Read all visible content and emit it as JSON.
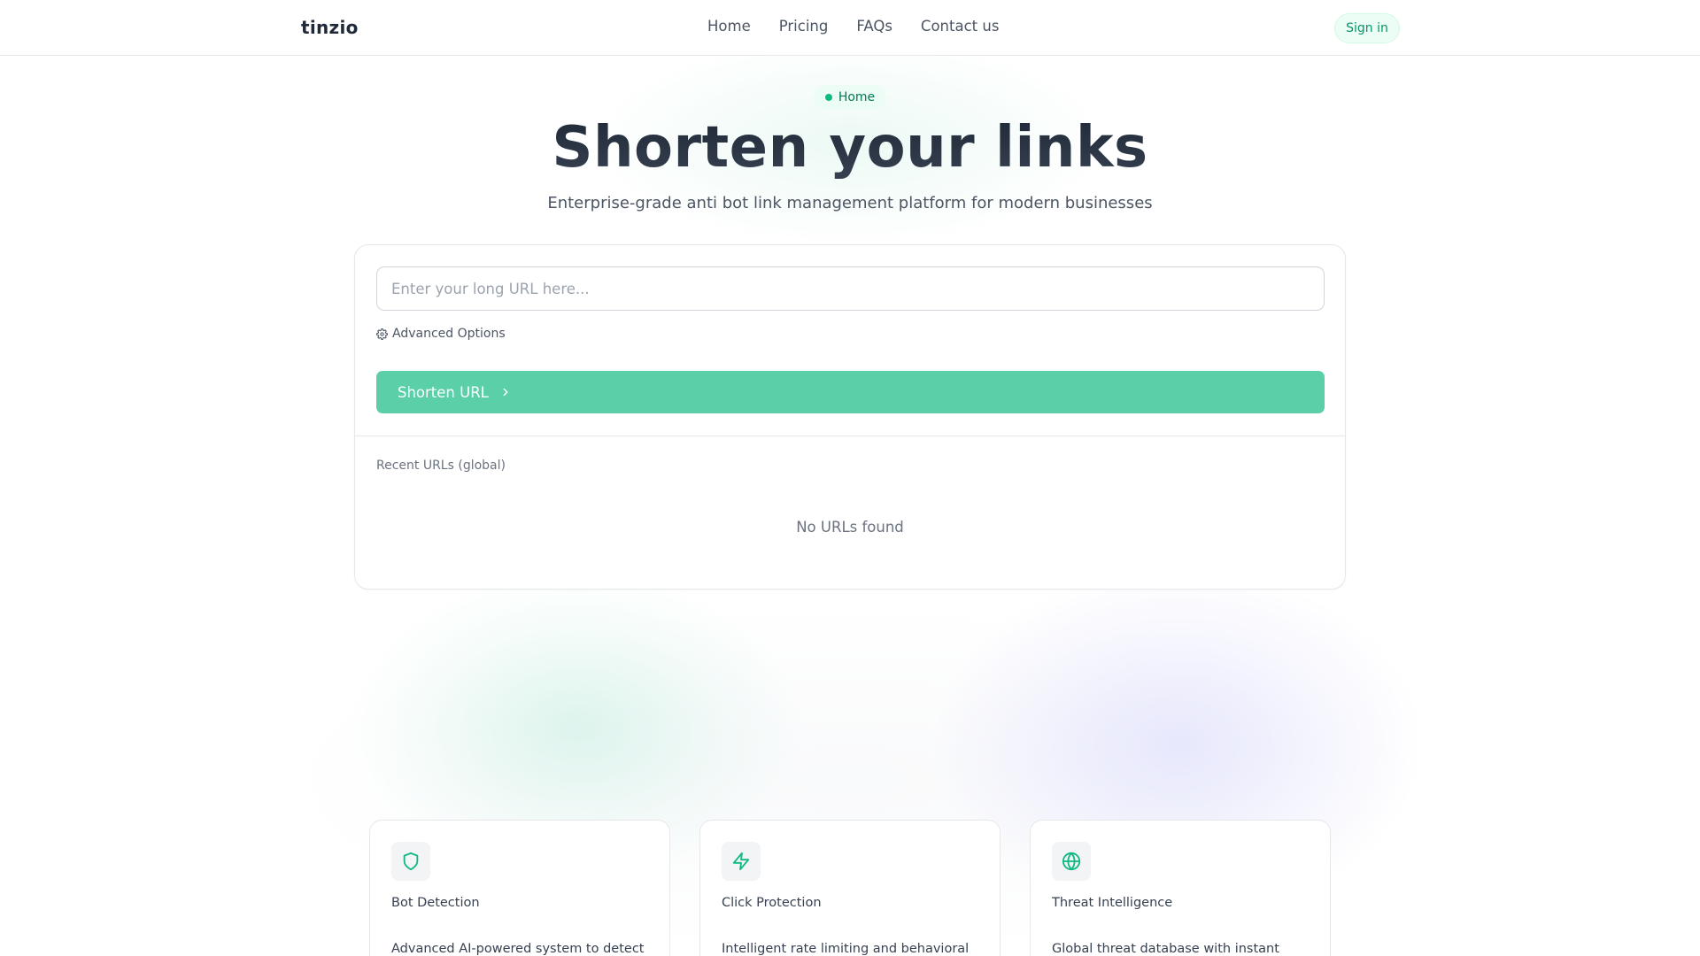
{
  "app": {
    "logo": "tinzio"
  },
  "nav": {
    "items": [
      {
        "label": "Home"
      },
      {
        "label": "Pricing"
      },
      {
        "label": "FAQs"
      },
      {
        "label": "Contact us"
      }
    ],
    "signin_label": "Sign in"
  },
  "hero": {
    "badge": "Home",
    "title": "Shorten your links",
    "subtitle": "Enterprise-grade anti bot link management platform for modern businesses"
  },
  "shortener": {
    "url_value": "",
    "url_placeholder": "Enter your long URL here...",
    "advanced_label": "Advanced Options",
    "button_label": "Shorten URL",
    "recent_label": "Recent URLs (global)",
    "empty_text": "No URLs found"
  },
  "features": [
    {
      "icon": "shield-icon",
      "title": "Bot Detection",
      "description": "Advanced AI-powered system to detect"
    },
    {
      "icon": "lightning-icon",
      "title": "Click Protection",
      "description": "Intelligent rate limiting and behavioral"
    },
    {
      "icon": "globe-icon",
      "title": "Threat Intelligence",
      "description": "Global threat database with instant"
    }
  ],
  "colors": {
    "accent": "#10b981",
    "button": "#5bcfa8",
    "badge_bg": "#ecfdf5",
    "title": "#2d3443"
  }
}
